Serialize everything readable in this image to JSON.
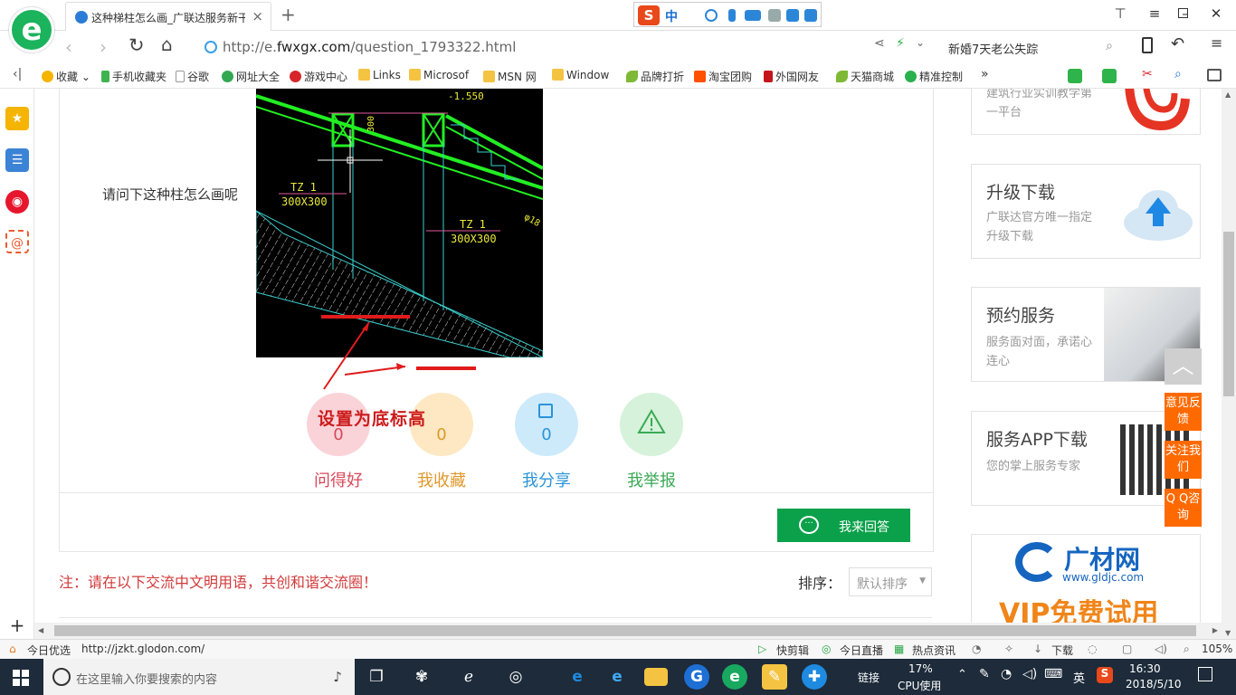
{
  "browser": {
    "logo_letter": "e",
    "tab_title": "这种梯柱怎么画_广联达服务新干线",
    "tab_close": "×",
    "new_tab": "+",
    "ime": {
      "logo": "S",
      "lang": "中"
    },
    "url_prefix": "http://e.",
    "url_host": "fwxgx.com",
    "url_path": "/question_1793322.html",
    "search_text": "新婚7天老公失踪",
    "search_icon": "search-icon"
  },
  "bookmarks": [
    {
      "label": "收藏",
      "icon": "star-icon",
      "color": "#f5b400"
    },
    {
      "label": "手机收藏夹",
      "icon": "phone-icon",
      "color": "#3fb34f"
    },
    {
      "label": "谷歌",
      "icon": "page-icon",
      "color": "#bbbbbb"
    },
    {
      "label": "网址大全",
      "icon": "sites-icon",
      "color": "#33a853"
    },
    {
      "label": "游戏中心",
      "icon": "game-icon",
      "color": "#d6262c"
    },
    {
      "label": "Links",
      "icon": "folder-icon",
      "color": "#f5c342"
    },
    {
      "label": "Microsof",
      "icon": "folder-icon",
      "color": "#f5c342"
    },
    {
      "label": "MSN 网",
      "icon": "folder-icon",
      "color": "#f5c342"
    },
    {
      "label": "Window",
      "icon": "folder-icon",
      "color": "#f5c342"
    },
    {
      "label": "品牌打折",
      "icon": "leaf-icon",
      "color": "#7db935"
    },
    {
      "label": "淘宝团购",
      "icon": "taobao-icon",
      "color": "#ff5000"
    },
    {
      "label": "外国网友",
      "icon": "bookmark-icon",
      "color": "#c4161c"
    },
    {
      "label": "天猫商城",
      "icon": "leaf-icon",
      "color": "#7db935"
    },
    {
      "label": "精准控制",
      "icon": "chat-icon",
      "color": "#28b14c"
    }
  ],
  "bookmark_more": "»",
  "page": {
    "question_text": "请问下这种柱怎么画呢",
    "annotation": "设置为底标高",
    "cad": {
      "dim_1550": "-1.550",
      "dim_300": "300",
      "tz1_a": "TZ 1",
      "tz1_a_size": "300X300",
      "tz1_b": "TZ 1",
      "tz1_b_size": "300X300",
      "phi": "φ18"
    },
    "actions": [
      {
        "label": "问得好",
        "count": "0",
        "color": "#f7d6da",
        "text": "#d9485a",
        "icon": "thumb-icon"
      },
      {
        "label": "我收藏",
        "count": "0",
        "color": "#fbe8c7",
        "text": "#e0982b",
        "icon": "star-outline-icon"
      },
      {
        "label": "我分享",
        "count": "0",
        "color": "#cfeafa",
        "text": "#2b94d8",
        "icon": "share-icon"
      },
      {
        "label": "我举报",
        "count": "",
        "color": "#d7f1dc",
        "text": "#3aaa55",
        "icon": "warning-icon"
      }
    ],
    "answer_button": "我来回答",
    "notice": "注：请在以下交流中文明用语，共创和谐交流圈！",
    "sort_label": "排序：",
    "sort_value": "默认排序"
  },
  "sidebar_ads": [
    {
      "title": "",
      "desc": "建筑行业实训教学第一平台"
    },
    {
      "title": "升级下载",
      "desc": "广联达官方唯一指定升级下载"
    },
    {
      "title": "预约服务",
      "desc": "服务面对面，承诺心连心"
    },
    {
      "title": "服务APP下载",
      "desc": "您的掌上服务专家"
    }
  ],
  "promo": {
    "brand": "广材网",
    "url": "www.gldjc.com",
    "slogan": "VIP免费试用"
  },
  "float_buttons": [
    "意见反馈",
    "关注我们",
    "Q Q咨询"
  ],
  "statusbar": {
    "left_label": "今日优选",
    "status_url": "http://jzkt.glodon.com/",
    "items": [
      "快剪辑",
      "今日直播",
      "热点资讯",
      "下载"
    ],
    "zoom": "105%"
  },
  "taskbar": {
    "search_placeholder": "在这里输入你要搜索的内容",
    "link_label": "链接",
    "cpu_percent": "17%",
    "cpu_label": "CPU使用",
    "lang": "英",
    "time": "16:30",
    "date": "2018/5/10"
  },
  "colors": {
    "brand_green": "#0aa14a",
    "notice_red": "#d23a3a",
    "float_orange": "#ff6a00"
  }
}
